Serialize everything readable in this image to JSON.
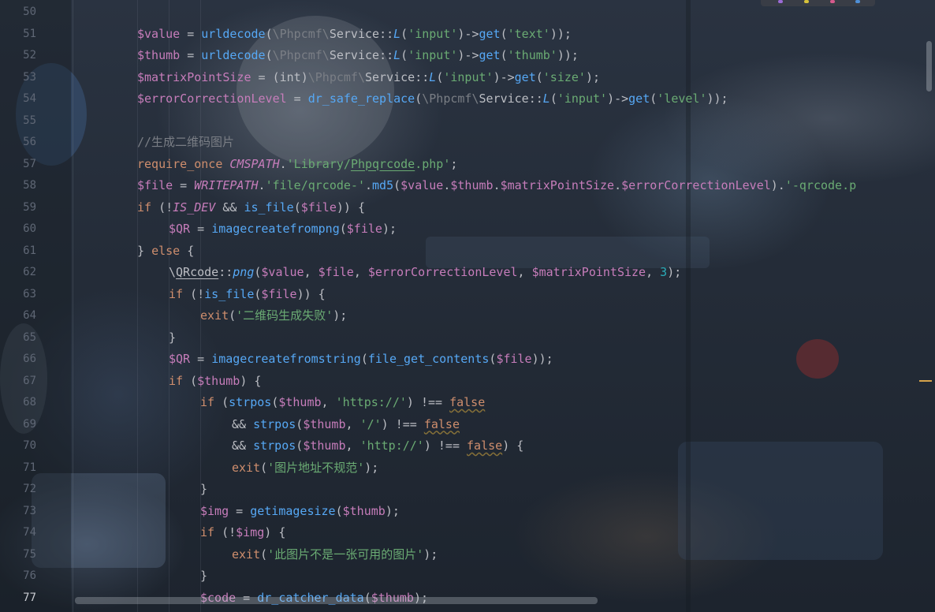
{
  "editor": {
    "lines": [
      {
        "n": "50",
        "tokens": []
      },
      {
        "n": "51",
        "tokens": [
          {
            "c": "v",
            "t": "$value"
          },
          {
            "c": "p",
            "t": " = "
          },
          {
            "c": "f",
            "t": "urldecode"
          },
          {
            "c": "p",
            "t": "("
          },
          {
            "c": "ns",
            "t": "\\Phpcmf\\"
          },
          {
            "c": "cl",
            "t": "Service"
          },
          {
            "c": "p",
            "t": "::"
          },
          {
            "c": "f it",
            "t": "L"
          },
          {
            "c": "p",
            "t": "("
          },
          {
            "c": "s",
            "t": "'input'"
          },
          {
            "c": "p",
            "t": ")->"
          },
          {
            "c": "f",
            "t": "get"
          },
          {
            "c": "p",
            "t": "("
          },
          {
            "c": "s",
            "t": "'text'"
          },
          {
            "c": "p",
            "t": "));"
          }
        ]
      },
      {
        "n": "52",
        "tokens": [
          {
            "c": "v",
            "t": "$thumb"
          },
          {
            "c": "p",
            "t": " = "
          },
          {
            "c": "f",
            "t": "urldecode"
          },
          {
            "c": "p",
            "t": "("
          },
          {
            "c": "ns",
            "t": "\\Phpcmf\\"
          },
          {
            "c": "cl",
            "t": "Service"
          },
          {
            "c": "p",
            "t": "::"
          },
          {
            "c": "f it",
            "t": "L"
          },
          {
            "c": "p",
            "t": "("
          },
          {
            "c": "s",
            "t": "'input'"
          },
          {
            "c": "p",
            "t": ")->"
          },
          {
            "c": "f",
            "t": "get"
          },
          {
            "c": "p",
            "t": "("
          },
          {
            "c": "s",
            "t": "'thumb'"
          },
          {
            "c": "p",
            "t": "));"
          }
        ]
      },
      {
        "n": "53",
        "tokens": [
          {
            "c": "v",
            "t": "$matrixPointSize"
          },
          {
            "c": "p",
            "t": " = (int)"
          },
          {
            "c": "ns",
            "t": "\\Phpcmf\\"
          },
          {
            "c": "cl",
            "t": "Service"
          },
          {
            "c": "p",
            "t": "::"
          },
          {
            "c": "f it",
            "t": "L"
          },
          {
            "c": "p",
            "t": "("
          },
          {
            "c": "s",
            "t": "'input'"
          },
          {
            "c": "p",
            "t": ")->"
          },
          {
            "c": "f",
            "t": "get"
          },
          {
            "c": "p",
            "t": "("
          },
          {
            "c": "s",
            "t": "'size'"
          },
          {
            "c": "p",
            "t": ");"
          }
        ]
      },
      {
        "n": "54",
        "tokens": [
          {
            "c": "v",
            "t": "$errorCorrectionLevel"
          },
          {
            "c": "p",
            "t": " = "
          },
          {
            "c": "f",
            "t": "dr_safe_replace"
          },
          {
            "c": "p",
            "t": "("
          },
          {
            "c": "ns",
            "t": "\\Phpcmf\\"
          },
          {
            "c": "cl",
            "t": "Service"
          },
          {
            "c": "p",
            "t": "::"
          },
          {
            "c": "f it",
            "t": "L"
          },
          {
            "c": "p",
            "t": "("
          },
          {
            "c": "s",
            "t": "'input'"
          },
          {
            "c": "p",
            "t": ")->"
          },
          {
            "c": "f",
            "t": "get"
          },
          {
            "c": "p",
            "t": "("
          },
          {
            "c": "s",
            "t": "'level'"
          },
          {
            "c": "p",
            "t": "));"
          }
        ]
      },
      {
        "n": "55",
        "tokens": []
      },
      {
        "n": "56",
        "tokens": [
          {
            "c": "c",
            "t": "//生成二维码图片"
          }
        ]
      },
      {
        "n": "57",
        "tokens": [
          {
            "c": "k",
            "t": "require_once "
          },
          {
            "c": "cn",
            "t": "CMSPATH"
          },
          {
            "c": "p",
            "t": "."
          },
          {
            "c": "s",
            "t": "'Library/"
          },
          {
            "c": "s u",
            "t": "Phpqrcode"
          },
          {
            "c": "s",
            "t": ".php'"
          },
          {
            "c": "p",
            "t": ";"
          }
        ]
      },
      {
        "n": "58",
        "tokens": [
          {
            "c": "v",
            "t": "$file"
          },
          {
            "c": "p",
            "t": " = "
          },
          {
            "c": "cn",
            "t": "WRITEPATH"
          },
          {
            "c": "p",
            "t": "."
          },
          {
            "c": "s",
            "t": "'file/qrcode-'"
          },
          {
            "c": "p",
            "t": "."
          },
          {
            "c": "f",
            "t": "md5"
          },
          {
            "c": "p",
            "t": "("
          },
          {
            "c": "v",
            "t": "$value"
          },
          {
            "c": "p",
            "t": "."
          },
          {
            "c": "v",
            "t": "$thumb"
          },
          {
            "c": "p",
            "t": "."
          },
          {
            "c": "v",
            "t": "$matrixPointSize"
          },
          {
            "c": "p",
            "t": "."
          },
          {
            "c": "v",
            "t": "$errorCorrectionLevel"
          },
          {
            "c": "p",
            "t": ")."
          },
          {
            "c": "s",
            "t": "'-qrcode.p"
          }
        ]
      },
      {
        "n": "59",
        "tokens": [
          {
            "c": "k",
            "t": "if "
          },
          {
            "c": "p",
            "t": "(!"
          },
          {
            "c": "cn",
            "t": "IS_DEV"
          },
          {
            "c": "p",
            "t": " && "
          },
          {
            "c": "f",
            "t": "is_file"
          },
          {
            "c": "p",
            "t": "("
          },
          {
            "c": "v",
            "t": "$file"
          },
          {
            "c": "p",
            "t": ")) {"
          }
        ]
      },
      {
        "n": "60",
        "indent": 1,
        "tokens": [
          {
            "c": "v",
            "t": "$QR"
          },
          {
            "c": "p",
            "t": " = "
          },
          {
            "c": "f",
            "t": "imagecreatefrompng"
          },
          {
            "c": "p",
            "t": "("
          },
          {
            "c": "v",
            "t": "$file"
          },
          {
            "c": "p",
            "t": ");"
          }
        ]
      },
      {
        "n": "61",
        "tokens": [
          {
            "c": "p",
            "t": "} "
          },
          {
            "c": "k",
            "t": "else"
          },
          {
            "c": "p",
            "t": " {"
          }
        ]
      },
      {
        "n": "62",
        "indent": 1,
        "tokens": [
          {
            "c": "p",
            "t": "\\"
          },
          {
            "c": "cl u",
            "t": "QRcode"
          },
          {
            "c": "p",
            "t": "::"
          },
          {
            "c": "f it",
            "t": "png"
          },
          {
            "c": "p",
            "t": "("
          },
          {
            "c": "v",
            "t": "$value"
          },
          {
            "c": "p",
            "t": ", "
          },
          {
            "c": "v",
            "t": "$file"
          },
          {
            "c": "p",
            "t": ", "
          },
          {
            "c": "v",
            "t": "$errorCorrectionLevel"
          },
          {
            "c": "p",
            "t": ", "
          },
          {
            "c": "v",
            "t": "$matrixPointSize"
          },
          {
            "c": "p",
            "t": ", "
          },
          {
            "c": "n",
            "t": "3"
          },
          {
            "c": "p",
            "t": ");"
          }
        ]
      },
      {
        "n": "63",
        "indent": 1,
        "tokens": [
          {
            "c": "k",
            "t": "if "
          },
          {
            "c": "p",
            "t": "(!"
          },
          {
            "c": "f",
            "t": "is_file"
          },
          {
            "c": "p",
            "t": "("
          },
          {
            "c": "v",
            "t": "$file"
          },
          {
            "c": "p",
            "t": ")) {"
          }
        ]
      },
      {
        "n": "64",
        "indent": 2,
        "tokens": [
          {
            "c": "k",
            "t": "exit"
          },
          {
            "c": "p",
            "t": "("
          },
          {
            "c": "s",
            "t": "'二维码生成失败'"
          },
          {
            "c": "p",
            "t": ");"
          }
        ]
      },
      {
        "n": "65",
        "indent": 1,
        "tokens": [
          {
            "c": "p",
            "t": "}"
          }
        ]
      },
      {
        "n": "66",
        "indent": 1,
        "tokens": [
          {
            "c": "v",
            "t": "$QR"
          },
          {
            "c": "p",
            "t": " = "
          },
          {
            "c": "f",
            "t": "imagecreatefromstring"
          },
          {
            "c": "p",
            "t": "("
          },
          {
            "c": "f",
            "t": "file_get_contents"
          },
          {
            "c": "p",
            "t": "("
          },
          {
            "c": "v",
            "t": "$file"
          },
          {
            "c": "p",
            "t": "));"
          }
        ]
      },
      {
        "n": "67",
        "indent": 1,
        "tokens": [
          {
            "c": "k",
            "t": "if "
          },
          {
            "c": "p",
            "t": "("
          },
          {
            "c": "v",
            "t": "$thumb"
          },
          {
            "c": "p",
            "t": ") {"
          }
        ]
      },
      {
        "n": "68",
        "indent": 2,
        "tokens": [
          {
            "c": "k",
            "t": "if "
          },
          {
            "c": "p",
            "t": "("
          },
          {
            "c": "f",
            "t": "strpos"
          },
          {
            "c": "p",
            "t": "("
          },
          {
            "c": "v",
            "t": "$thumb"
          },
          {
            "c": "p",
            "t": ", "
          },
          {
            "c": "s",
            "t": "'https://'"
          },
          {
            "c": "p",
            "t": ") !== "
          },
          {
            "c": "k warn",
            "t": "false"
          }
        ]
      },
      {
        "n": "69",
        "indent": 3,
        "tokens": [
          {
            "c": "p",
            "t": "&& "
          },
          {
            "c": "f",
            "t": "strpos"
          },
          {
            "c": "p",
            "t": "("
          },
          {
            "c": "v",
            "t": "$thumb"
          },
          {
            "c": "p",
            "t": ", "
          },
          {
            "c": "s",
            "t": "'/'"
          },
          {
            "c": "p",
            "t": ") !== "
          },
          {
            "c": "k warn",
            "t": "false"
          }
        ]
      },
      {
        "n": "70",
        "indent": 3,
        "tokens": [
          {
            "c": "p",
            "t": "&& "
          },
          {
            "c": "f",
            "t": "strpos"
          },
          {
            "c": "p",
            "t": "("
          },
          {
            "c": "v",
            "t": "$thumb"
          },
          {
            "c": "p",
            "t": ", "
          },
          {
            "c": "s",
            "t": "'http://'"
          },
          {
            "c": "p",
            "t": ") !== "
          },
          {
            "c": "k warn",
            "t": "false"
          },
          {
            "c": "p",
            "t": ") {"
          }
        ]
      },
      {
        "n": "71",
        "indent": 3,
        "tokens": [
          {
            "c": "k",
            "t": "exit"
          },
          {
            "c": "p",
            "t": "("
          },
          {
            "c": "s",
            "t": "'图片地址不规范'"
          },
          {
            "c": "p",
            "t": ");"
          }
        ]
      },
      {
        "n": "72",
        "indent": 2,
        "tokens": [
          {
            "c": "p",
            "t": "}"
          }
        ]
      },
      {
        "n": "73",
        "indent": 2,
        "tokens": [
          {
            "c": "v",
            "t": "$img"
          },
          {
            "c": "p",
            "t": " = "
          },
          {
            "c": "f",
            "t": "getimagesize"
          },
          {
            "c": "p",
            "t": "("
          },
          {
            "c": "v",
            "t": "$thumb"
          },
          {
            "c": "p",
            "t": ");"
          }
        ]
      },
      {
        "n": "74",
        "indent": 2,
        "tokens": [
          {
            "c": "k",
            "t": "if "
          },
          {
            "c": "p",
            "t": "(!"
          },
          {
            "c": "v",
            "t": "$img"
          },
          {
            "c": "p",
            "t": ") {"
          }
        ]
      },
      {
        "n": "75",
        "indent": 3,
        "tokens": [
          {
            "c": "k",
            "t": "exit"
          },
          {
            "c": "p",
            "t": "("
          },
          {
            "c": "s",
            "t": "'此图片不是一张可用的图片'"
          },
          {
            "c": "p",
            "t": ");"
          }
        ]
      },
      {
        "n": "76",
        "indent": 2,
        "tokens": [
          {
            "c": "p",
            "t": "}"
          }
        ]
      },
      {
        "n": "77",
        "indent": 2,
        "current": true,
        "tokens": [
          {
            "c": "v",
            "t": "$code"
          },
          {
            "c": "p",
            "t": " = "
          },
          {
            "c": "f",
            "t": "dr_catcher_data"
          },
          {
            "c": "p",
            "t": "("
          },
          {
            "c": "v",
            "t": "$thumb"
          },
          {
            "c": "p",
            "t": ");"
          }
        ]
      }
    ]
  }
}
